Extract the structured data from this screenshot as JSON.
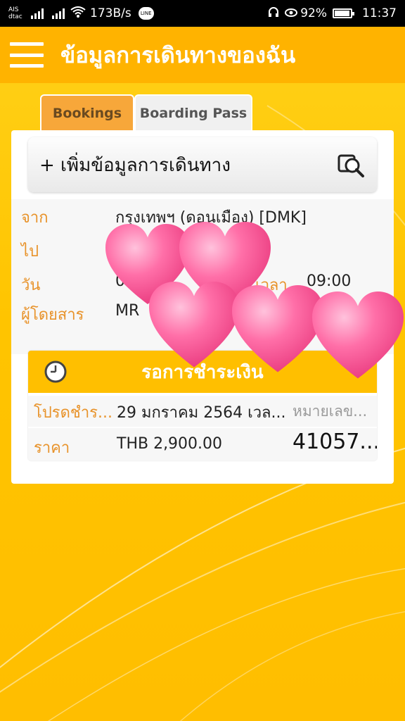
{
  "status_bar": {
    "carrier_1": "AIS",
    "carrier_2": "dtac",
    "speed": "173B/s",
    "chat_icon_label": "LINE",
    "battery": "92%",
    "time": "11:37"
  },
  "app_bar": {
    "title": "ข้อมูลการเดินทางของฉัน"
  },
  "tabs": [
    {
      "label": "Bookings",
      "active": true
    },
    {
      "label": "Boarding Pass",
      "active": false
    }
  ],
  "add_trip": {
    "label": "+ เพิ่มข้อมูลการเดินทาง"
  },
  "booking": {
    "from_label": "จาก",
    "from_value": "กรุงเทพฯ (ดอนเมือง) [DMK]",
    "to_label": "ไป",
    "date_label": "วัน",
    "date_value": "0",
    "time_label": "เวลา",
    "time_value": "09:00",
    "passenger_label": "ผู้โดยสาร",
    "passenger_value": "MR"
  },
  "payment": {
    "status": "รอการชำระเงิน",
    "due_label": "โปรดชำร...",
    "due_value": "29 มกราคม 2564 เวล...",
    "ref_label": "หมายเลข...",
    "price_label": "ราคา",
    "price_value": "THB 2,900.00",
    "ref_value": "41057..."
  },
  "colors": {
    "brand_yellow": "#ffc400",
    "app_bar": "#ffb300",
    "label_orange": "#e8932b",
    "active_tab": "#f7a73a",
    "heart_pink": "#ff5c9a"
  }
}
